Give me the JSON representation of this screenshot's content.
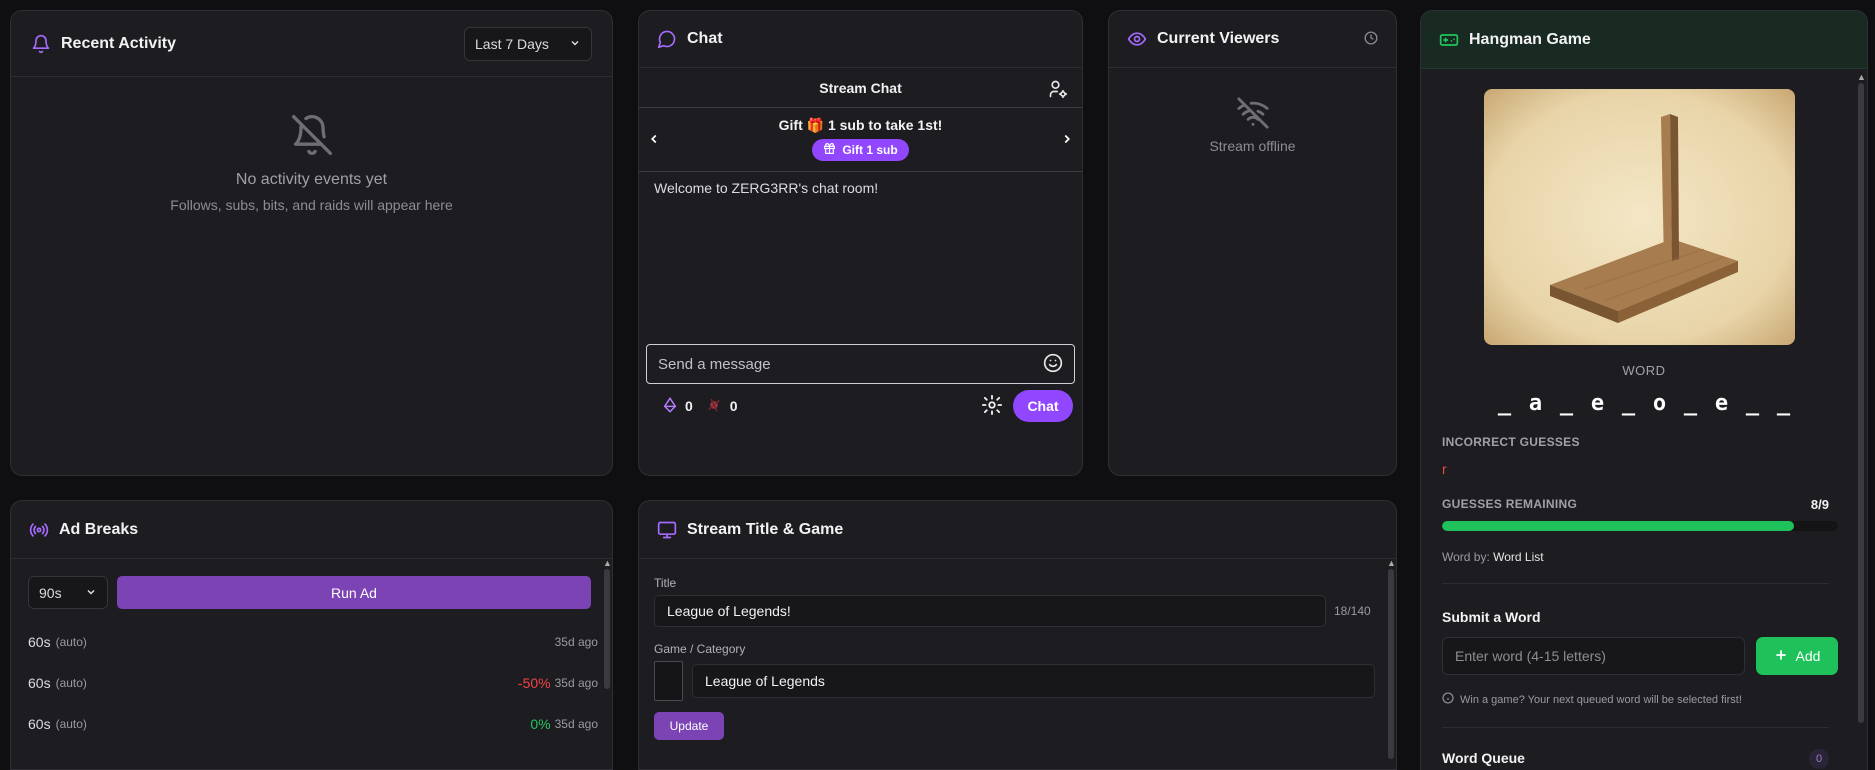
{
  "recent": {
    "title": "Recent Activity",
    "range": "Last 7 Days",
    "empty_title": "No activity events yet",
    "empty_sub": "Follows, subs, bits, and raids will appear here"
  },
  "chat": {
    "title": "Chat",
    "stream_chat": "Stream Chat",
    "gift_prefix": "Gift ",
    "gift_suffix": " 1 sub to take 1st!",
    "gift_button": "Gift 1 sub",
    "welcome": "Welcome to ZERG3RR's chat room!",
    "input_placeholder": "Send a message",
    "points": "0",
    "bits": "0",
    "send_label": "Chat"
  },
  "viewers": {
    "title": "Current Viewers",
    "offline": "Stream offline"
  },
  "hangman": {
    "title": "Hangman Game",
    "word_label": "WORD",
    "letters": [
      "_",
      "a",
      "_",
      "e",
      "_",
      "o",
      "_",
      "e",
      "_",
      "_"
    ],
    "incorrect_label": "INCORRECT GUESSES",
    "incorrect": "r",
    "remaining_label": "GUESSES REMAINING",
    "remaining": "8/9",
    "remaining_fraction": 0.889,
    "word_by_label": "Word by: ",
    "word_by": "Word List",
    "submit_title": "Submit a Word",
    "submit_placeholder": "Enter word (4-15 letters)",
    "add_label": "Add",
    "hint": "Win a game? Your next queued word will be selected first!",
    "queue_title": "Word Queue",
    "queue_count": "0"
  },
  "ads": {
    "title": "Ad Breaks",
    "duration": "90s",
    "run_label": "Run Ad",
    "rows": [
      {
        "dur": "60s",
        "tag": "(auto)",
        "change": "",
        "change_color": "",
        "ago": "35d ago"
      },
      {
        "dur": "60s",
        "tag": "(auto)",
        "change": "-50%",
        "change_color": "#ef4444",
        "ago": "35d ago"
      },
      {
        "dur": "60s",
        "tag": "(auto)",
        "change": "0%",
        "change_color": "#22c55e",
        "ago": "35d ago"
      }
    ]
  },
  "stream": {
    "title": "Stream Title & Game",
    "title_label": "Title",
    "title_value": "League of Legends!",
    "title_count": "18/140",
    "game_label": "Game / Category",
    "game_value": "League of Legends",
    "update_label": "Update"
  },
  "colors": {
    "accent": "#9147ff",
    "green": "#1fc15b",
    "red": "#ef4444"
  }
}
